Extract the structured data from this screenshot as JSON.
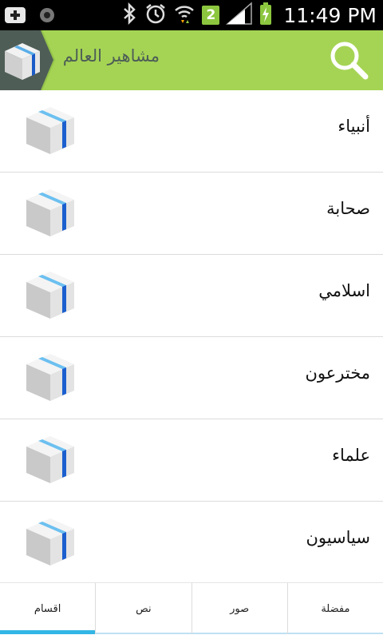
{
  "status_bar": {
    "time": "11:49 PM",
    "notification_badge": "2",
    "icons": [
      "add-notification-icon",
      "record-icon",
      "bluetooth-icon",
      "alarm-icon",
      "wifi-icon",
      "notification-count-icon",
      "signal-icon",
      "battery-charging-icon"
    ]
  },
  "action_bar": {
    "title": "مشاهير العالم",
    "background_color": "#a5d454",
    "logo_icon": "box-icon",
    "search_icon": "search-icon"
  },
  "categories": [
    {
      "label": "أنبياء",
      "icon": "box-icon"
    },
    {
      "label": "صحابة",
      "icon": "box-icon"
    },
    {
      "label": "اسلامي",
      "icon": "box-icon"
    },
    {
      "label": "مخترعون",
      "icon": "box-icon"
    },
    {
      "label": "علماء",
      "icon": "box-icon"
    },
    {
      "label": "سياسيون",
      "icon": "box-icon"
    }
  ],
  "tabs": [
    {
      "label": "اقسام",
      "active": true
    },
    {
      "label": "نص",
      "active": false
    },
    {
      "label": "صور",
      "active": false
    },
    {
      "label": "مفضلة",
      "active": false
    }
  ],
  "colors": {
    "accent": "#33b5e5",
    "header": "#a5d454",
    "title_text": "#4d5d57"
  }
}
